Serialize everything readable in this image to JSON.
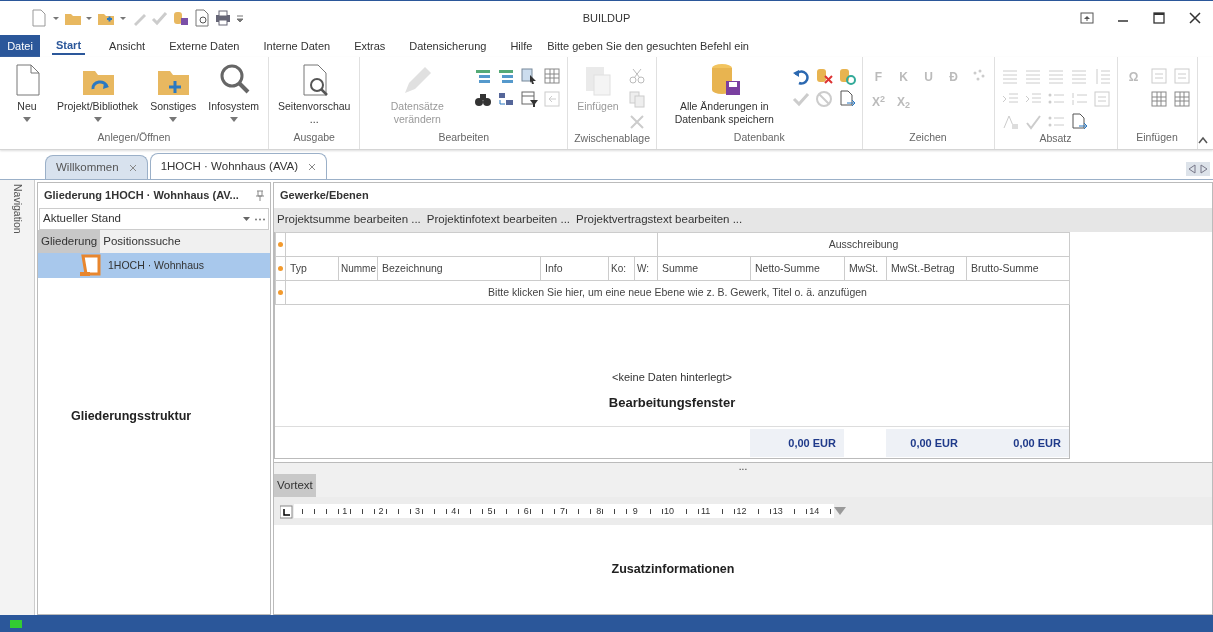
{
  "window": {
    "title": "BUILDUP"
  },
  "menu_tabs": [
    {
      "label": "Datei",
      "kind": "file",
      "selected": false
    },
    {
      "label": "Start",
      "kind": "tab",
      "selected": true
    },
    {
      "label": "Ansicht",
      "kind": "tab",
      "selected": false
    },
    {
      "label": "Externe Daten",
      "kind": "tab",
      "selected": false
    },
    {
      "label": "Interne Daten",
      "kind": "tab",
      "selected": false
    },
    {
      "label": "Extras",
      "kind": "tab",
      "selected": false
    },
    {
      "label": "Datensicherung",
      "kind": "tab",
      "selected": false
    },
    {
      "label": "Hilfe",
      "kind": "tab",
      "selected": false
    }
  ],
  "command_search": {
    "placeholder": "Bitte geben Sie den gesuchten Befehl ein"
  },
  "ribbon_groups": [
    {
      "label": "Anlegen/Öffnen",
      "items": [
        {
          "kind": "large",
          "label": "Neu",
          "dropdown": true,
          "disabled": false
        },
        {
          "kind": "large",
          "label": "Projekt/Bibliothek",
          "dropdown": true,
          "disabled": false
        },
        {
          "kind": "large",
          "label": "Sonstiges",
          "dropdown": true,
          "disabled": false
        },
        {
          "kind": "large",
          "label": "Infosystem",
          "dropdown": true,
          "disabled": false
        }
      ]
    },
    {
      "label": "Ausgabe",
      "items": [
        {
          "kind": "large",
          "label": "Seitenvorschau",
          "more": "...",
          "dropdown": false,
          "disabled": false
        }
      ]
    },
    {
      "label": "Bearbeiten",
      "items": [
        {
          "kind": "large",
          "label": "Datensätze verändern",
          "dropdown": false,
          "disabled": true
        },
        {
          "kind": "tools"
        }
      ]
    },
    {
      "label": "Zwischenablage",
      "items": [
        {
          "kind": "large",
          "label": "Einfügen",
          "dropdown": false,
          "disabled": true
        },
        {
          "kind": "tools"
        }
      ]
    },
    {
      "label": "Datenbank",
      "items": [
        {
          "kind": "large",
          "label": "Alle Änderungen in Datenbank speichern",
          "dropdown": false,
          "disabled": false
        },
        {
          "kind": "tools"
        }
      ]
    },
    {
      "label": "Zeichen",
      "items": [
        {
          "kind": "letters",
          "letters": [
            "F",
            "K",
            "U",
            "Ð",
            "X$^{2}$",
            "X$_{2}$"
          ]
        },
        {
          "kind": "tools"
        }
      ]
    },
    {
      "label": "Absatz",
      "items": [
        {
          "kind": "tools"
        }
      ]
    },
    {
      "label": "Einfügen",
      "items": [
        {
          "kind": "letters",
          "letters": [
            "Ω"
          ]
        },
        {
          "kind": "tools"
        }
      ]
    }
  ],
  "doc_tabs": [
    {
      "label": "Willkommen",
      "selected": false
    },
    {
      "label": "1HOCH · Wohnhaus (AVA)",
      "selected": true
    }
  ],
  "side_label": "Navigation",
  "outline_panel": {
    "title": "Gliederung 1HOCH · Wohnhaus (AV...",
    "state": {
      "value": "Aktueller Stand"
    },
    "tabs": [
      {
        "label": "Gliederung",
        "selected": true
      },
      {
        "label": "Positionssuche",
        "selected": false
      }
    ],
    "tree": [
      {
        "label": "1HOCH · Wohnhaus",
        "selected": true
      }
    ],
    "caption": "Gliederungsstruktur"
  },
  "main_panel": {
    "title": "Gewerke/Ebenen",
    "actions": [
      "Projektsumme bearbeiten ...",
      "Projektinfotext bearbeiten ...",
      "Projektvertragstext bearbeiten ..."
    ],
    "grid": {
      "band": "Ausschreibung",
      "columns": [
        {
          "label": "Typ"
        },
        {
          "label": "Numme"
        },
        {
          "label": "Bezeichnung"
        },
        {
          "label": "Info"
        },
        {
          "label": "Ko:"
        },
        {
          "label": "W:"
        },
        {
          "label": "Summe"
        },
        {
          "label": "Netto-Summe",
          "total": "0,00 EUR"
        },
        {
          "label": "MwSt."
        },
        {
          "label": "MwSt.-Betrag",
          "total": "0,00 EUR"
        },
        {
          "label": "Brutto-Summe",
          "total": "0,00 EUR"
        }
      ],
      "new_row_hint": "Bitte klicken Sie hier, um eine neue Ebene wie z. B. Gewerk, Titel o. ä. anzufügen",
      "empty_text": "<keine Daten hinterlegt>",
      "caption": "Bearbeitungsfenster"
    },
    "splitter": "...",
    "text_tab": "Vortext",
    "ruler": [
      "1",
      "2",
      "3",
      "4",
      "5",
      "6",
      "7",
      "8",
      "9",
      "10",
      "11",
      "12",
      "13",
      "14"
    ],
    "caption": "Zusatzinformationen"
  }
}
